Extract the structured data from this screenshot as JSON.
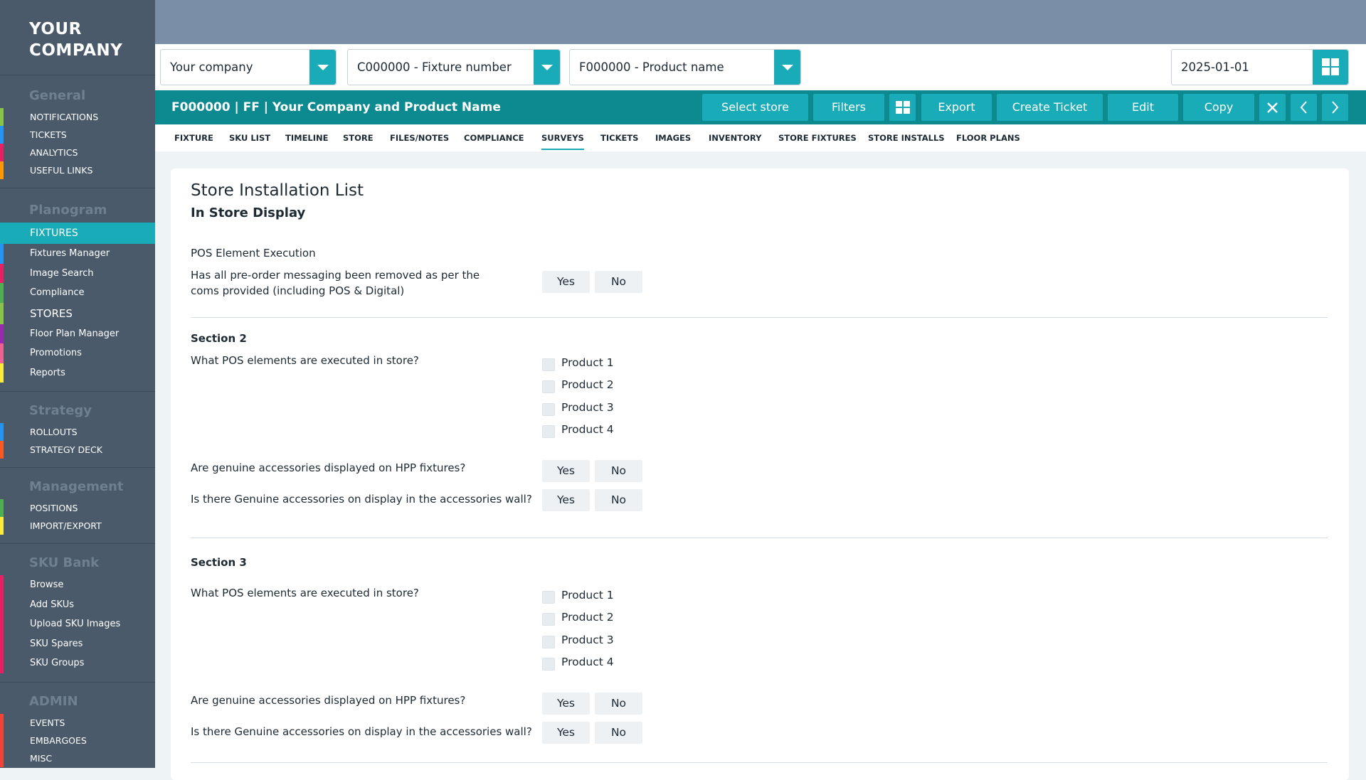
{
  "brand": {
    "line1": "YOUR",
    "line2": "COMPANY"
  },
  "sidebar": {
    "general": {
      "heading": "General",
      "items": [
        {
          "label": "NOTIFICATIONS",
          "color": "#8bc34a"
        },
        {
          "label": "TICKETS",
          "color": "#2196f3"
        },
        {
          "label": "ANALYTICS",
          "color": "#e91e63"
        },
        {
          "label": "USEFUL LINKS",
          "color": "#ff9800"
        }
      ]
    },
    "planogram": {
      "heading": "Planogram",
      "active": {
        "label": "FIXTURES"
      },
      "sub1": [
        {
          "label": "Fixtures Manager",
          "color": "#2196f3"
        },
        {
          "label": "Image Search",
          "color": "#e91e63"
        },
        {
          "label": "Compliance",
          "color": "#4caf50"
        }
      ],
      "stores": {
        "label": "STORES",
        "color": "#8bc34a"
      },
      "sub2": [
        {
          "label": "Floor Plan Manager",
          "color": "#9c27b0"
        },
        {
          "label": "Promotions",
          "color": "#f06292"
        },
        {
          "label": "Reports",
          "color": "#ffeb3b"
        }
      ]
    },
    "strategy": {
      "heading": "Strategy",
      "items": [
        {
          "label": "ROLLOUTS",
          "color": "#2196f3"
        },
        {
          "label": "STRATEGY DECK",
          "color": "#ff5722"
        }
      ]
    },
    "management": {
      "heading": "Management",
      "items": [
        {
          "label": "POSITIONS",
          "color": "#4caf50"
        },
        {
          "label": "IMPORT/EXPORT",
          "color": "#ffeb3b"
        }
      ]
    },
    "skubank": {
      "heading": "SKU Bank",
      "items": [
        {
          "label": "Browse",
          "color": "#e91e63"
        },
        {
          "label": "Add SKUs",
          "color": "#e91e63"
        },
        {
          "label": "Upload SKU Images",
          "color": "#e91e63"
        },
        {
          "label": "SKU Spares",
          "color": "#e91e63"
        },
        {
          "label": "SKU Groups",
          "color": "#e91e63"
        }
      ]
    },
    "admin": {
      "heading": "ADMIN",
      "items": [
        {
          "label": "EVENTS",
          "color": "#f44336"
        },
        {
          "label": "EMBARGOES",
          "color": "#f44336"
        },
        {
          "label": "MISC",
          "color": "#f44336"
        }
      ]
    }
  },
  "selectors": {
    "company": "Your company",
    "fixture": "C000000 - Fixture number",
    "product": "F000000 - Product name",
    "date": "2025-01-01"
  },
  "titlebar": {
    "title": "F000000 | FF | Your Company and Product Name",
    "select_store": "Select store",
    "filters": "Filters",
    "export": "Export",
    "create_ticket": "Create Ticket",
    "edit": "Edit",
    "copy": "Copy"
  },
  "tabs": [
    "FIXTURE",
    "SKU LIST",
    "TIMELINE",
    "STORE",
    "FILES/NOTES",
    "COMPLIANCE",
    "SURVEYS",
    "TICKETS",
    "IMAGES",
    "INVENTORY",
    "STORE FIXTURES",
    "STORE INSTALLS",
    "FLOOR PLANS"
  ],
  "active_tab": "SURVEYS",
  "card": {
    "title": "Store Installation List",
    "subtitle": "In Store Display",
    "pos_heading": "POS Element Execution",
    "q1_line1": "Has all pre-order messaging been removed as per the",
    "q1_line2": "coms provided (including POS & Digital)",
    "yes": "Yes",
    "no": "No",
    "sections": [
      {
        "title": "Section 2",
        "q_elements": "What POS elements are executed in store?",
        "products": [
          "Product 1",
          "Product 2",
          "Product 3",
          "Product 4"
        ],
        "q_hpp": "Are genuine accessories displayed on HPP fixtures?",
        "q_wall": "Is there Genuine accessories on display in the accessories wall?"
      },
      {
        "title": "Section 3",
        "q_elements": "What POS elements are executed in store?",
        "products": [
          "Product 1",
          "Product 2",
          "Product 3",
          "Product 4"
        ],
        "q_hpp": "Are genuine accessories displayed on HPP fixtures?",
        "q_wall": "Is there Genuine accessories on display in the accessories wall?"
      }
    ]
  },
  "colors": {
    "teal": "#1aabb8",
    "dark_teal": "#0d8a90",
    "sidebar": "#4a5a6a",
    "topband": "#7a8ea8"
  }
}
